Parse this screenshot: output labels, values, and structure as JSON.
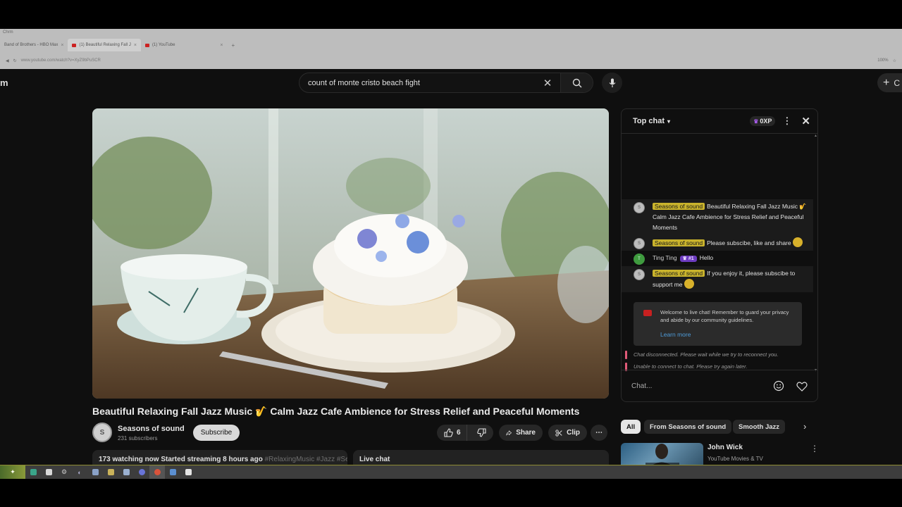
{
  "browser": {
    "window_title": "Chrm",
    "tabs": [
      {
        "label": "Band of Brothers - HBO Max"
      },
      {
        "label": "(1) Beautiful Relaxing Fall J"
      },
      {
        "label": "(1) YouTube"
      }
    ],
    "url": "www.youtube.com/watch?v=XyZ9bPuSCR",
    "zoom": "100%"
  },
  "header": {
    "logo_fragment": "m",
    "search": {
      "value": "count of monte cristo beach fight"
    },
    "create_label": "C"
  },
  "video": {
    "title": "Beautiful Relaxing Fall Jazz Music 🎷 Calm Jazz Cafe Ambience for Stress Relief and Peaceful Moments",
    "channel": {
      "name": "Seasons of sound",
      "subscribers": "231 subscribers",
      "avatar_initial": "S"
    },
    "subscribe_label": "Subscribe",
    "actions": {
      "likes": "6",
      "share": "Share",
      "clip": "Clip"
    },
    "description": {
      "meta": "173 watching now  Started streaming 8 hours ago",
      "tags": " #RelaxingMusic #Jazz #Se"
    },
    "live_chat_label": "Live chat"
  },
  "chat": {
    "header": {
      "mode": "Top chat",
      "xp": "0XP"
    },
    "messages": [
      {
        "author": "Seasons of sound",
        "text": "Beautiful Relaxing Fall Jazz Music 🎷 Calm Jazz Cafe Ambience for Stress Relief and Peaceful Moments"
      },
      {
        "author": "Seasons of sound",
        "text": "Please subscibe, like and share"
      },
      {
        "author": "Ting Ting",
        "badge": "#1",
        "text": "Hello",
        "avatar_initial": "T"
      },
      {
        "author": "Seasons of sound",
        "text": "If you enjoy it, please subscibe to support me"
      }
    ],
    "welcome": {
      "text": "Welcome to live chat! Remember to guard your privacy and abide by our community guidelines.",
      "learn_more": "Learn more"
    },
    "system": [
      "Chat disconnected. Please wait while we try to reconnect you.",
      "Unable to connect to chat. Please try again later."
    ],
    "input_placeholder": "Chat..."
  },
  "chips": [
    "All",
    "From Seasons of sound",
    "Smooth Jazz"
  ],
  "related": [
    {
      "title": "John Wick",
      "channel": "YouTube Movies & TV"
    }
  ],
  "colors": {
    "author_highlight": "#c9b32c",
    "member_badge": "#6c3bbf",
    "link": "#4e9bd8",
    "system_bar": "#e05a78"
  }
}
